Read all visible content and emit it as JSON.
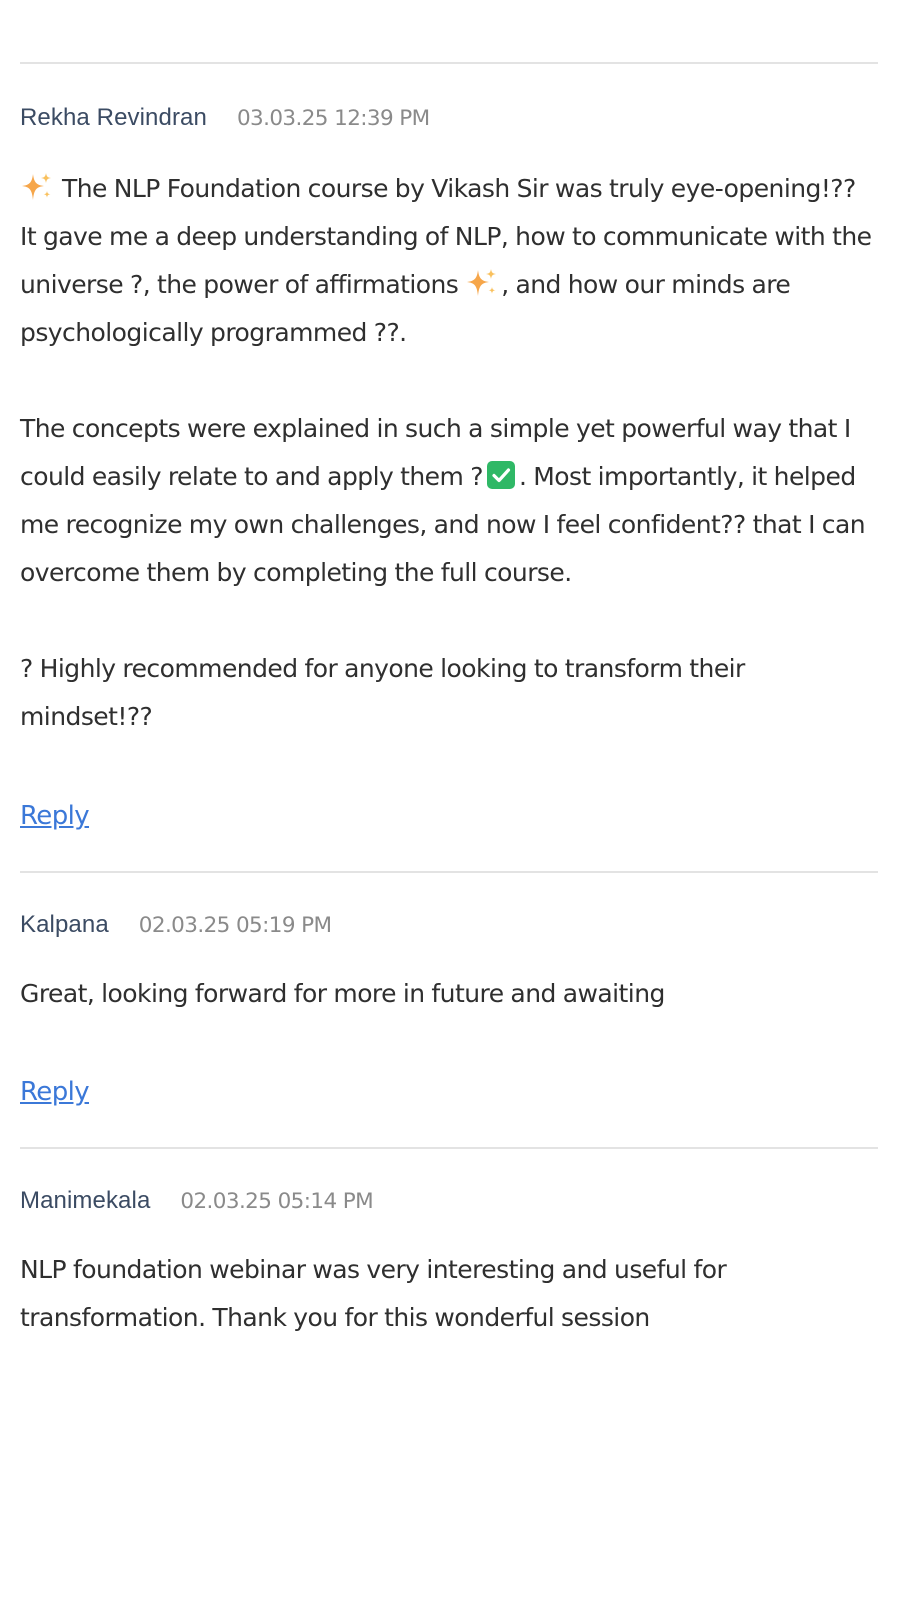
{
  "comments": [
    {
      "author": "Rekha Revindran",
      "timestamp": "03.03.25 12:39 PM",
      "p1_after_sparkle": "The NLP Foundation course by Vikash Sir was truly eye-opening!?? It gave me a deep understanding of NLP, how to communicate with the universe ?, the power of affirmations ",
      "p1_end": ", and how our minds are psychologically programmed ??.",
      "p2_start": "The concepts were explained in such a simple yet powerful way that I could easily relate to and apply them ?",
      "p2_end": ". Most importantly, it helped me recognize my own challenges, and now I feel confident?? that I can overcome them by completing the full course.",
      "p3": "? Highly recommended for anyone looking to transform their mindset!??",
      "reply_label": "Reply"
    },
    {
      "author": "Kalpana",
      "timestamp": "02.03.25 05:19 PM",
      "text": "Great, looking forward for more in future and awaiting",
      "reply_label": "Reply"
    },
    {
      "author": "Manimekala",
      "timestamp": "02.03.25 05:14 PM",
      "text": "NLP foundation webinar was very interesting and useful for transformation. Thank you for this wonderful session"
    }
  ],
  "icons": {
    "sparkle": "sparkles-emoji-icon",
    "check": "check-mark-button-emoji-icon"
  },
  "colors": {
    "link": "#3b78d8",
    "author": "#3b4b63",
    "timestamp": "#8a8a8a",
    "divider": "#e3e3e3",
    "sparkle": "#f6a64a",
    "check_bg": "#2fb866"
  }
}
